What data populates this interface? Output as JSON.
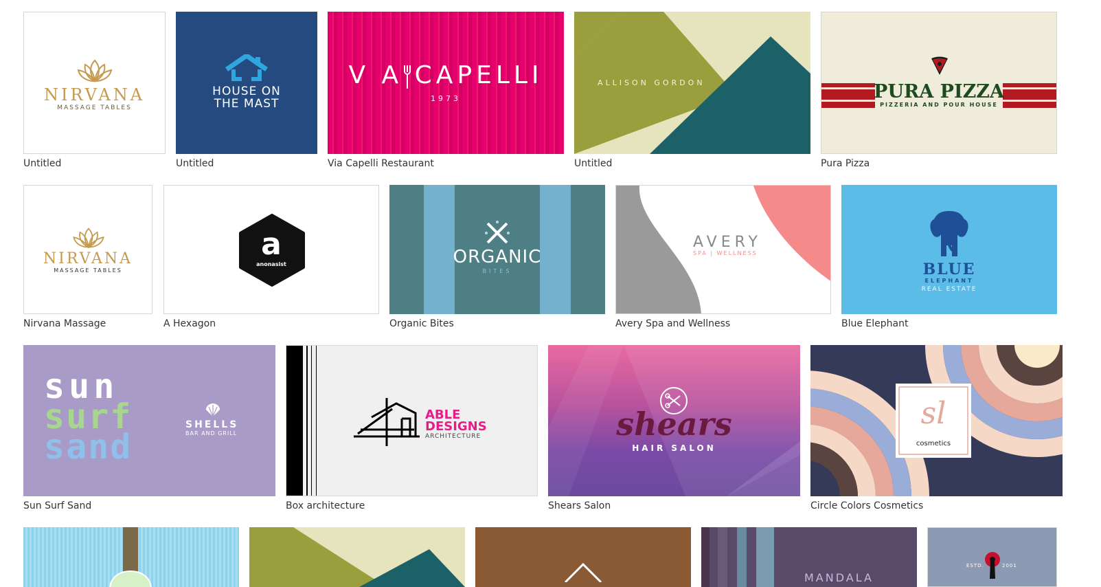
{
  "templates": [
    {
      "caption": "Untitled",
      "logo_text": "NIRVANA",
      "tagline": "MASSAGE TABLES",
      "icon": "lotus-icon"
    },
    {
      "caption": "Untitled",
      "line1": "HOUSE ON",
      "line2": "THE MAST",
      "icon": "house-icon"
    },
    {
      "caption": "Via Capelli Restaurant",
      "logo_text": "V  A CAPELLI",
      "year": "1973",
      "icon": "fork-icon"
    },
    {
      "caption": "Untitled",
      "logo_text": "ALLISON GORDON"
    },
    {
      "caption": "Pura Pizza",
      "logo_text": "PURA PIZZA",
      "tagline": "PIZZERIA AND POUR HOUSE",
      "icon": "pizza-icon"
    },
    {
      "caption": "Nirvana Massage",
      "logo_text": "NIRVANA",
      "tagline": "MASSAGE TABLES",
      "icon": "lotus-icon"
    },
    {
      "caption": "A Hexagon",
      "logo_letter": "a",
      "logo_text": "anonasist",
      "icon": "hexagon-icon"
    },
    {
      "caption": "Organic Bites",
      "logo_text": "ORGANIC",
      "tagline": "BITES",
      "icon": "fork-knife-icon"
    },
    {
      "caption": "Avery Spa and Wellness",
      "logo_text": "AVERY",
      "tagline": "SPA | WELLNESS"
    },
    {
      "caption": "Blue Elephant",
      "logo_text": "BLUE",
      "line2": "ELEPHANT",
      "line3": "REAL ESTATE",
      "icon": "elephant-icon"
    },
    {
      "caption": "Sun Surf Sand",
      "line1": "sun",
      "line2": "surf",
      "line3": "sand",
      "logo_text": "SHELLS",
      "tagline": "BAR AND GRILL",
      "icon": "shell-icon"
    },
    {
      "caption": "Box architecture",
      "line1": "ABLE",
      "line2": "DESIGNS",
      "tagline": "ARCHITECTURE",
      "icon": "house-outline-icon"
    },
    {
      "caption": "Shears Salon",
      "logo_text": "shears",
      "tagline": "HAIR SALON",
      "icon": "scissors-icon"
    },
    {
      "caption": "Circle Colors Cosmetics",
      "logo_text": "sl",
      "tagline": "cosmetics"
    }
  ],
  "partial_row": [
    {
      "icon": "cupcake-icon"
    },
    {},
    {
      "icon": "diamond-icon"
    },
    {
      "text": "MANDALA"
    },
    {
      "estd": "ESTD.",
      "year": "2001",
      "icon": "keyhole-icon"
    }
  ],
  "colors": {
    "nirvana_gold": "#c59a4e",
    "mast_blue": "#244a80",
    "mast_sky": "#2fa6e0",
    "capelli_pink": "#e6006e",
    "allison_olive": "#9a9e3c",
    "allison_teal": "#1c6068",
    "allison_cream": "#e6e4bc",
    "pizza_red": "#b01a20",
    "pizza_green": "#1e4a1e",
    "pizza_bg": "#efecdc",
    "organic_teal": "#4e7f84",
    "organic_light": "#73b1cc",
    "avery_gray": "#9a9a9a",
    "avery_pink": "#f48a8a",
    "elephant_bg": "#5bbce8",
    "elephant_navy": "#1f4f96",
    "sun_bg": "#a99bc8",
    "able_magenta": "#e61c88",
    "shears_wine": "#6a1a3e",
    "circle_navy": "#343a58"
  }
}
